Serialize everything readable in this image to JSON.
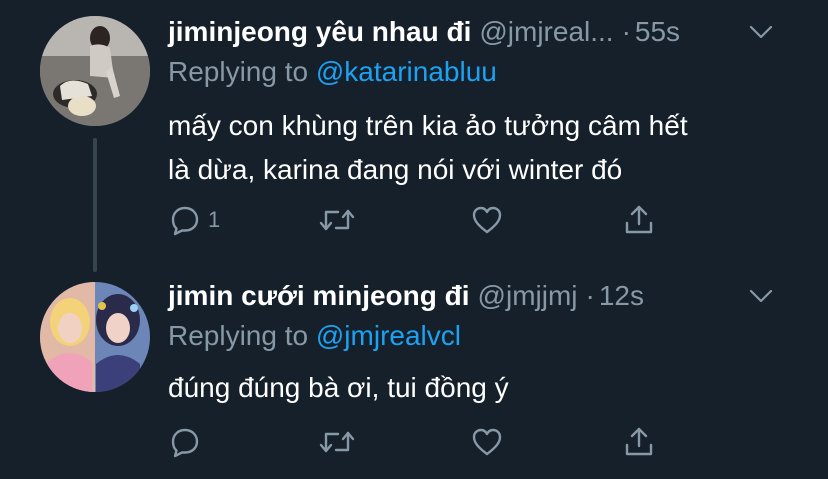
{
  "tweets": [
    {
      "display_name": "jiminjeong yêu nhau đi",
      "handle": "@jmjreal...",
      "separator": "·",
      "time": "55s",
      "replying_prefix": "Replying to",
      "replying_to": "@katarinabluu",
      "text_line1": "mấy con khùng trên kia ảo tưởng câm hết",
      "text_line2": "là dừa, karina đang nói với winter đó",
      "reply_count": "1",
      "icons": [
        "reply-icon",
        "retweet-icon",
        "like-icon",
        "share-icon",
        "chevron-down-icon"
      ]
    },
    {
      "display_name": "jimin cưới minjeong đi",
      "handle": "@jmjjmj",
      "separator": "·",
      "time": "12s",
      "replying_prefix": "Replying to",
      "replying_to": "@jmjrealvcl",
      "text_line1": "đúng đúng bà ơi, tui đồng ý",
      "icons": [
        "reply-icon",
        "retweet-icon",
        "like-icon",
        "share-icon",
        "chevron-down-icon"
      ]
    }
  ],
  "colors": {
    "background": "#15202b",
    "primary_text": "#ffffff",
    "secondary_text": "#8899a6",
    "link": "#1da1f2",
    "thread_line": "#38444d"
  }
}
